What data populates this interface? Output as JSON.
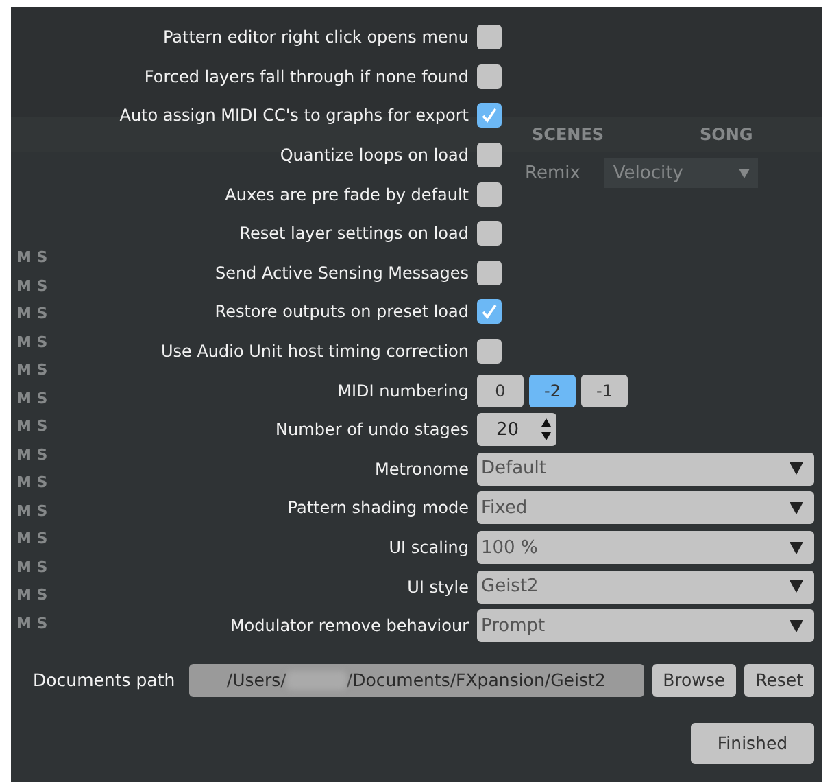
{
  "background_app": {
    "tabs": [
      "SCENES",
      "SONG"
    ],
    "toolbar": {
      "button": "Remix",
      "dropdown": "Velocity"
    },
    "track_rows": [
      "M S",
      "M S",
      "M S",
      "M S",
      "M S",
      "M S",
      "M S",
      "M S",
      "M S",
      "M S",
      "M S",
      "M S",
      "M S",
      "M S"
    ]
  },
  "settings": [
    {
      "kind": "checkbox",
      "label": "Pattern editor right click opens menu",
      "checked": false
    },
    {
      "kind": "checkbox",
      "label": "Forced layers fall through if none found",
      "checked": false
    },
    {
      "kind": "checkbox",
      "label": "Auto assign MIDI CC's to graphs for export",
      "checked": true
    },
    {
      "kind": "checkbox",
      "label": "Quantize loops on load",
      "checked": false
    },
    {
      "kind": "checkbox",
      "label": "Auxes are pre fade by default",
      "checked": false
    },
    {
      "kind": "checkbox",
      "label": "Reset layer settings on load",
      "checked": false
    },
    {
      "kind": "checkbox",
      "label": "Send Active Sensing Messages",
      "checked": false
    },
    {
      "kind": "checkbox",
      "label": "Restore outputs on preset load",
      "checked": true
    },
    {
      "kind": "checkbox",
      "label": "Use Audio Unit host timing correction",
      "checked": false
    },
    {
      "kind": "segmented",
      "label": "MIDI numbering",
      "options": [
        {
          "label": "0",
          "selected": false
        },
        {
          "label": "-2",
          "selected": true
        },
        {
          "label": "-1",
          "selected": false
        }
      ]
    },
    {
      "kind": "spinner",
      "label": "Number of undo stages",
      "value": "20"
    },
    {
      "kind": "dropdown",
      "label": "Metronome",
      "value": "Default"
    },
    {
      "kind": "dropdown",
      "label": "Pattern shading mode",
      "value": "Fixed"
    },
    {
      "kind": "dropdown",
      "label": "UI scaling",
      "value": "100 %"
    },
    {
      "kind": "dropdown",
      "label": "UI style",
      "value": "Geist2"
    },
    {
      "kind": "dropdown",
      "label": "Modulator remove behaviour",
      "value": "Prompt"
    }
  ],
  "documents_path": {
    "label": "Documents path",
    "prefix": "/Users/",
    "suffix": "/Documents/FXpansion/Geist2",
    "buttons": [
      "Browse",
      "Reset"
    ]
  },
  "finish_button": "Finished"
}
